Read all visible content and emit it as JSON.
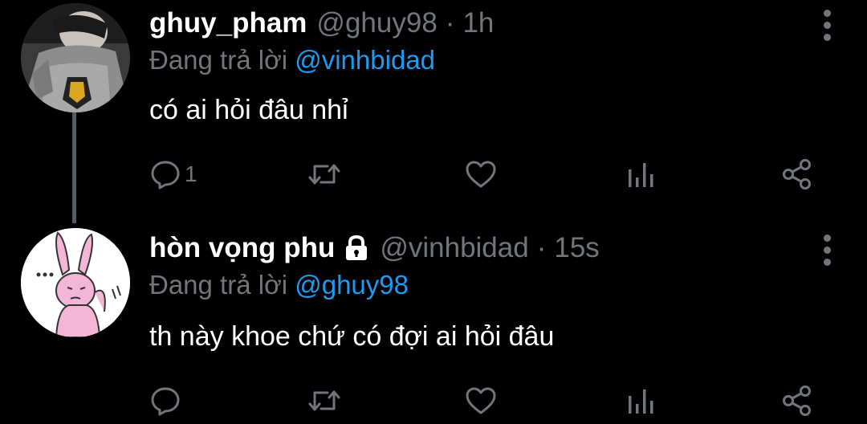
{
  "tweets": [
    {
      "display_name": "ghuy_pham",
      "handle": "@ghuy98",
      "separator": "·",
      "time": "1h",
      "replying_prefix": "Đang trả lời",
      "replying_to": "@vinhbidad",
      "text": "có ai hỏi đâu nhỉ",
      "reply_count": "1",
      "protected": false
    },
    {
      "display_name": "hòn vọng phu",
      "handle": "@vinhbidad",
      "separator": "·",
      "time": "15s",
      "replying_prefix": "Đang trả lời",
      "replying_to": "@ghuy98",
      "text": "th này khoe chứ có đợi ai hỏi đâu",
      "reply_count": "",
      "protected": true
    }
  ],
  "icons": {
    "reply": "comment-bubble-icon",
    "retweet": "retweet-icon",
    "like": "heart-icon",
    "stats": "bar-chart-icon",
    "share": "share-icon",
    "more": "vertical-dots-icon",
    "lock": "lock-icon"
  },
  "colors": {
    "background": "#000000",
    "text": "#ffffff",
    "muted": "#71767b",
    "link": "#1d9bf0",
    "thread_line": "#555b60"
  }
}
